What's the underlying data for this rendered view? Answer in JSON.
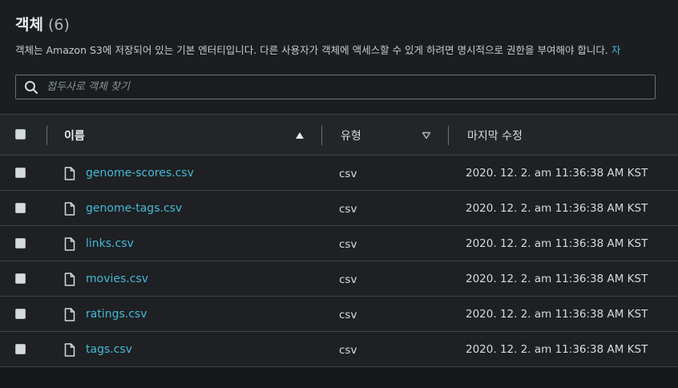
{
  "header": {
    "title": "객체",
    "count": "(6)",
    "description": "객체는 Amazon S3에 저장되어 있는 기본 엔터티입니다. 다른 사용자가 객체에 액세스할 수 있게 하려면 명시적으로 권한을 부여해야 합니다.",
    "description_link": "자"
  },
  "search": {
    "placeholder": "접두사로 객체 찾기",
    "value": ""
  },
  "table": {
    "columns": {
      "name": "이름",
      "type": "유형",
      "modified": "마지막 수정"
    },
    "rows": [
      {
        "name": "genome-scores.csv",
        "type": "csv",
        "modified": "2020. 12. 2. am 11:36:38 AM KST"
      },
      {
        "name": "genome-tags.csv",
        "type": "csv",
        "modified": "2020. 12. 2. am 11:36:38 AM KST"
      },
      {
        "name": "links.csv",
        "type": "csv",
        "modified": "2020. 12. 2. am 11:36:38 AM KST"
      },
      {
        "name": "movies.csv",
        "type": "csv",
        "modified": "2020. 12. 2. am 11:36:38 AM KST"
      },
      {
        "name": "ratings.csv",
        "type": "csv",
        "modified": "2020. 12. 2. am 11:36:38 AM KST"
      },
      {
        "name": "tags.csv",
        "type": "csv",
        "modified": "2020. 12. 2. am 11:36:38 AM KST"
      }
    ]
  },
  "colors": {
    "link": "#44b9d6",
    "background": "#1a1c20",
    "header_row": "#232629",
    "border": "#3c4248"
  },
  "icons": {
    "search": "search-icon",
    "sort_asc": "sort-ascending-icon",
    "sort_desc": "sort-descending-icon",
    "file": "file-icon"
  }
}
